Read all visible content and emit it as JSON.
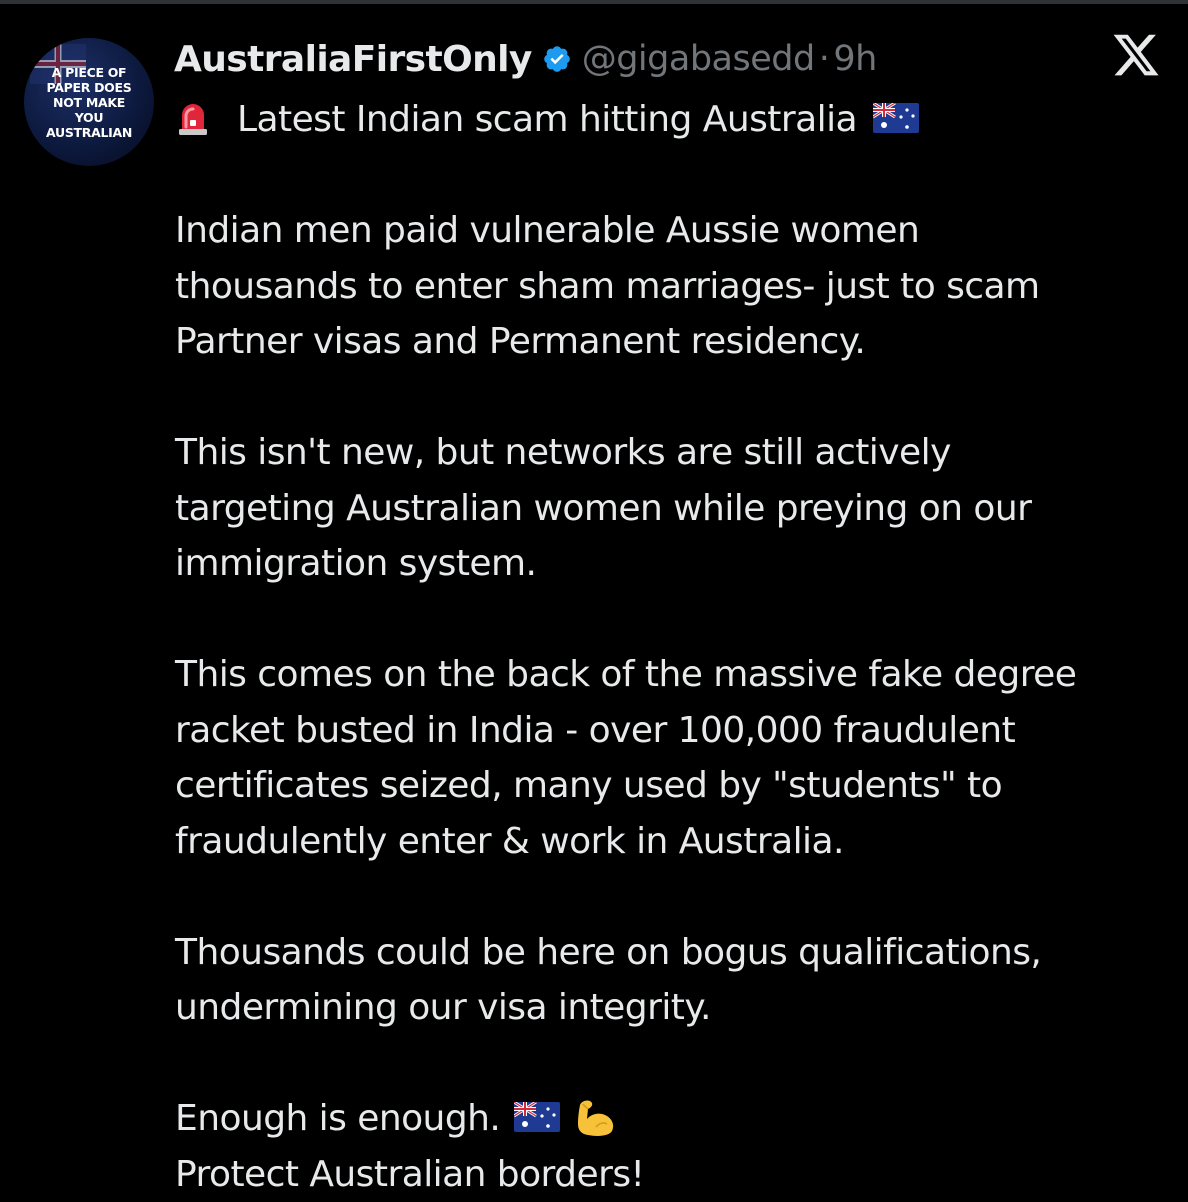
{
  "post": {
    "author": {
      "display_name": "AustraliaFirstOnly",
      "handle": "@gigabasedd",
      "separator": "·",
      "time": "9h",
      "verified": true,
      "avatar_text": [
        "A PIECE OF",
        "PAPER DOES",
        "NOT MAKE",
        "YOU",
        "AUSTRALIAN"
      ]
    },
    "icons": {
      "verified": "verified-badge-icon",
      "close": "x-logo-icon",
      "siren": "police-siren-icon",
      "flag": "australia-flag-icon",
      "muscle": "flexed-biceps-icon"
    },
    "headline": "Latest Indian scam hitting Australia",
    "paragraphs": [
      [
        "Indian men paid vulnerable Aussie women",
        "thousands to enter sham marriages- just to scam",
        "Partner visas and Permanent residency."
      ],
      [
        "This isn't new, but networks are still actively",
        "targeting Australian women while preying on our",
        "immigration system."
      ],
      [
        "This comes on the back of the massive fake degree",
        "racket busted in India - over 100,000 fraudulent",
        "certificates seized, many used by \"students\" to",
        "fraudulently enter & work in Australia."
      ],
      [
        "Thousands could be here on bogus qualifications,",
        "undermining our visa integrity."
      ]
    ],
    "closing": {
      "line1": "Enough is enough.",
      "line2": "Protect Australian borders!"
    }
  },
  "colors": {
    "background": "#000000",
    "text_primary": "#e7e9ea",
    "text_secondary": "#71767b",
    "verified_blue": "#1d9bf0",
    "siren_red": "#e0263a"
  }
}
